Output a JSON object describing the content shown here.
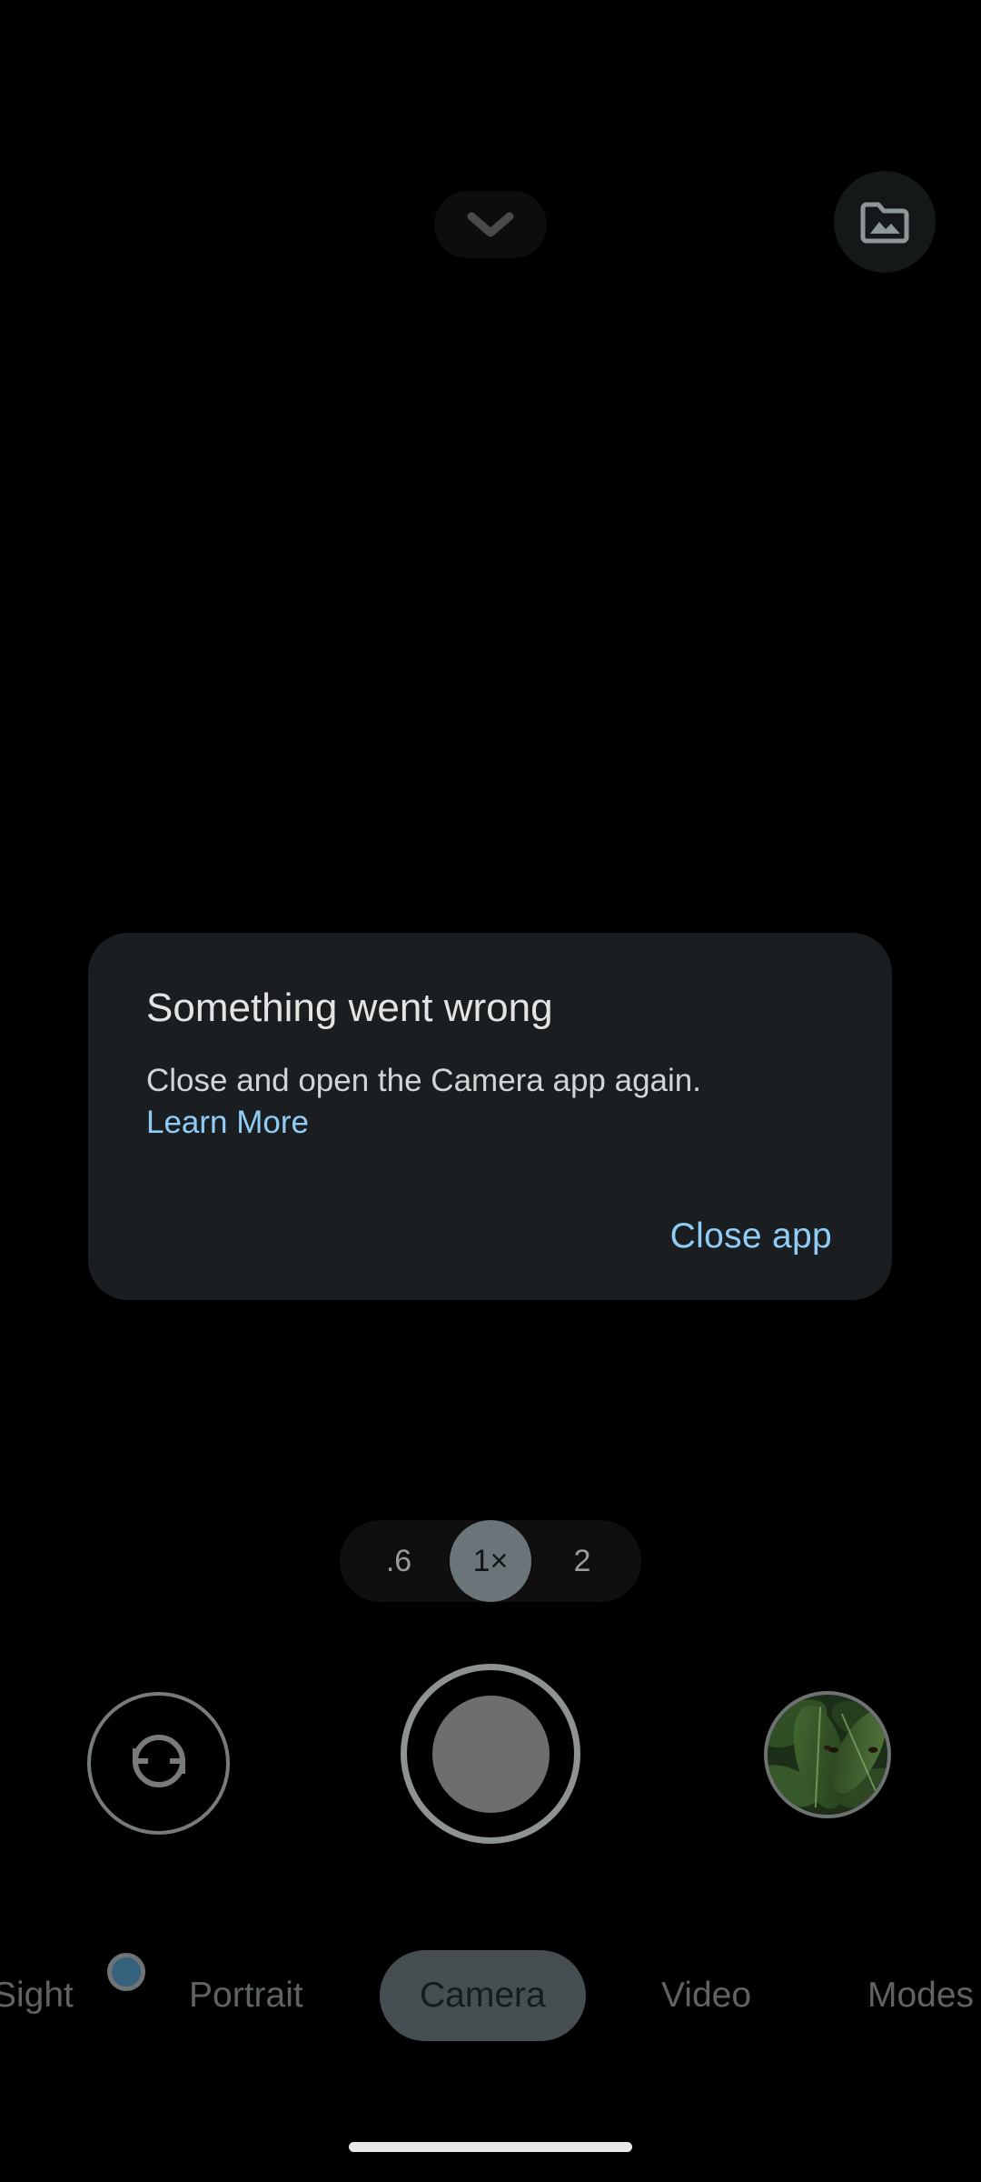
{
  "app": {
    "name": "Camera",
    "theme": "dark",
    "background_color": "#000000"
  },
  "top_bar": {
    "expand_settings": {
      "icon": "chevron-down-icon",
      "label": "",
      "pill_color": "#0d0d0d",
      "icon_color": "#4a4a4a"
    },
    "gallery": {
      "icon": "photo-folder-icon",
      "label": "",
      "circle_color": "#151818",
      "icon_color": "#8e9699"
    }
  },
  "dialog": {
    "visible": true,
    "title": "Something went wrong",
    "body": "Close and open the Camera app again.",
    "learn_more_label": "Learn More",
    "close_app_label": "Close app",
    "surface_color": "#1a1e20",
    "title_color": "#e4e4e4",
    "body_color": "#d2d4d6",
    "accent_color": "#8fcdf7"
  },
  "zoom_control": {
    "options": [
      {
        "label": ".6",
        "value": "0.6",
        "selected": false
      },
      {
        "label": "1×",
        "value": "1",
        "selected": true
      },
      {
        "label": "2",
        "value": "2",
        "selected": false
      }
    ],
    "selected_label": "1×",
    "track_color": "#0f0f0f",
    "selected_chip_color": "#6a7479",
    "option_color": "#9b9b9b"
  },
  "controls": {
    "camera_flip": {
      "icon": "camera-flip-icon",
      "label": "",
      "stroke_color": "#777b7c"
    },
    "shutter": {
      "icon": "shutter-icon",
      "label": "",
      "ring_color": "#8f9293",
      "inner_color": "#6e6e6e",
      "enabled": false
    },
    "thumbnail": {
      "icon": "last-photo-thumbnail",
      "label": "",
      "description": "green leaves",
      "ring_color": "#6f7273"
    }
  },
  "mode_selector": {
    "modes": [
      {
        "label": "Sight",
        "selected": false,
        "has_indicator": true
      },
      {
        "label": "Portrait",
        "selected": false,
        "has_indicator": false
      },
      {
        "label": "Camera",
        "selected": true,
        "has_indicator": false
      },
      {
        "label": "Video",
        "selected": false,
        "has_indicator": false
      },
      {
        "label": "Modes",
        "selected": false,
        "has_indicator": false
      }
    ],
    "selected_label": "Camera",
    "inactive_color": "#5f6365",
    "selected_text_color": "#161b1d",
    "selected_pill_color": "#474e52",
    "indicator_dot_color": "#35617d"
  },
  "system": {
    "home_indicator_color": "#e8e8e8"
  }
}
